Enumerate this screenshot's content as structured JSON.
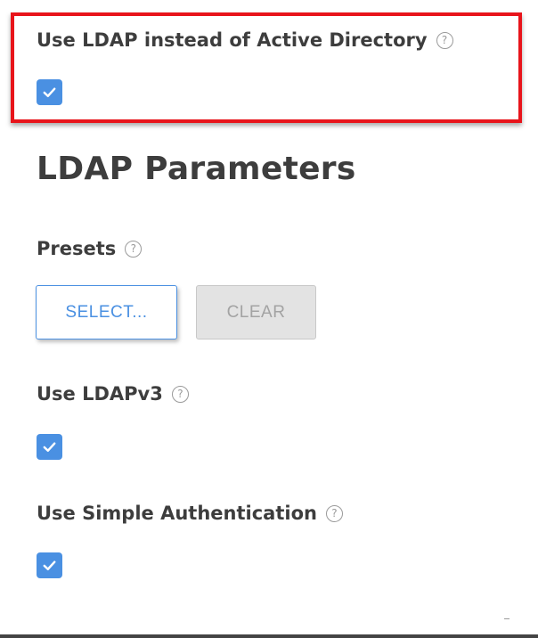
{
  "ldap_toggle": {
    "label": "Use LDAP instead of Active Directory",
    "help_glyph": "?",
    "checked": true
  },
  "section": {
    "title": "LDAP Parameters"
  },
  "presets": {
    "label": "Presets",
    "help_glyph": "?",
    "select_label": "SELECT...",
    "clear_label": "CLEAR"
  },
  "ldapv3": {
    "label": "Use LDAPv3",
    "help_glyph": "?",
    "checked": true
  },
  "simple_auth": {
    "label": "Use Simple Authentication",
    "help_glyph": "?",
    "checked": true
  },
  "colors": {
    "accent": "#4a90e2",
    "highlight": "#e8141b",
    "text": "#3d3d3d",
    "disabled_bg": "#e3e3e3"
  },
  "icons": {
    "help": "help-circle-icon",
    "check": "checkmark-icon"
  }
}
